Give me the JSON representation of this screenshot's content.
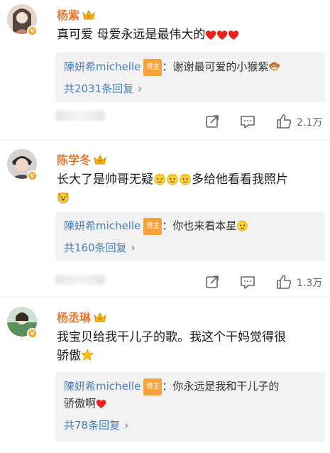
{
  "comments": [
    {
      "user": "杨紫",
      "verified_badge": "V",
      "text": "真可爱 母爱永远是最伟大的",
      "text_emojis": [
        "heart",
        "heart",
        "heart"
      ],
      "reply": {
        "author": "陳妍希michelle",
        "tag": "博主",
        "text": "：谢谢最可爱的小猴紫",
        "emoji": "monkey"
      },
      "more_replies": "共2031条回复",
      "likes": "2.1万"
    },
    {
      "user": "陈学冬",
      "verified_badge": "V",
      "text_part1": "长大了是帅哥无疑",
      "text_part2": "多给他看看我照片",
      "text_emojis": [
        "crown-face",
        "crown-face",
        "crown-face",
        "dog-face"
      ],
      "reply": {
        "author": "陳妍希michelle",
        "tag": "博主",
        "text": "：你也来看本星",
        "emoji": "star-face"
      },
      "more_replies": "共160条回复",
      "likes": "1.3万"
    },
    {
      "user": "杨丞琳",
      "verified_badge": "V",
      "text_line1": "我宝贝给我干儿子的歌。我这个干妈觉得很",
      "text_line2": "骄傲",
      "text_emojis": [
        "star"
      ],
      "reply": {
        "author": "陳妍希michelle",
        "tag": "博主",
        "text": "：你永远是我和干儿子的",
        "text_line2": "骄傲啊",
        "emoji": "heart"
      },
      "more_replies": "共78条回复"
    }
  ],
  "icons": [
    "share-icon",
    "comment-icon",
    "like-icon",
    "chevron-right-icon",
    "crown-icon"
  ],
  "colors": {
    "name": "#e8772c",
    "link": "#4a7fb8",
    "tag": "#f7a23b",
    "reply_bg": "#f2f2f2"
  }
}
